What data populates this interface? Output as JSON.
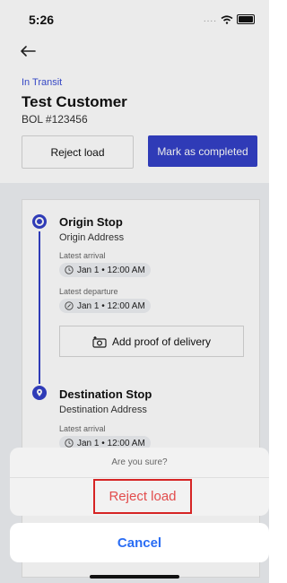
{
  "status_bar": {
    "time": "5:26"
  },
  "header": {
    "status": "In Transit",
    "customer_name": "Test Customer",
    "bol": "BOL #123456",
    "reject_label": "Reject load",
    "complete_label": "Mark as completed"
  },
  "stops": [
    {
      "title": "Origin Stop",
      "address": "Origin Address",
      "latest_arrival_label": "Latest arrival",
      "latest_arrival": "Jan 1 • 12:00 AM",
      "latest_departure_label": "Latest departure",
      "latest_departure": "Jan 1 • 12:00 AM",
      "proof_label": "Add proof of delivery"
    },
    {
      "title": "Destination Stop",
      "address": "Destination Address",
      "latest_arrival_label": "Latest arrival",
      "latest_arrival": "Jan 1 • 12:00 AM"
    }
  ],
  "action_sheet": {
    "title": "Are you sure?",
    "confirm_label": "Reject load",
    "cancel_label": "Cancel"
  },
  "colors": {
    "accent": "#3340c7",
    "danger": "#e24c4c",
    "link": "#2a6df4"
  }
}
